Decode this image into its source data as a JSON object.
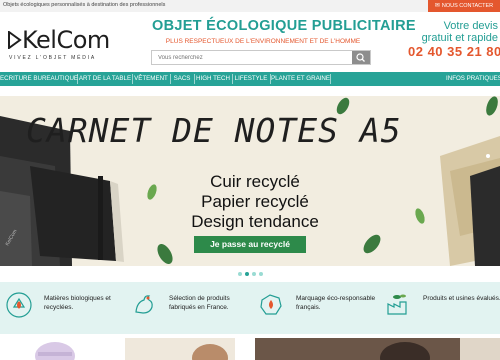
{
  "topbar": {
    "text": "Objets écologiques personnalisés à destination des professionnels",
    "contact_label": "NOUS CONTACTER"
  },
  "header": {
    "logo_text": "KelCom",
    "logo_tagline": "VIVEZ L'OBJET MÉDIA",
    "headline": "OBJET ÉCOLOGIQUE PUBLICITAIRE",
    "subline": "PLUS RESPECTUEUX DE L'ENVIRONNEMENT ET DE L'HOMME",
    "search_placeholder": "Vous recherchez",
    "devis_line1": "Votre devis",
    "devis_line2": "gratuit et rapide",
    "phone": "02 40 35 21 80"
  },
  "nav": {
    "items": [
      "ECRITURE BUREAUTIQUE",
      "ART DE LA TABLE",
      "VÊTEMENT",
      "SACS",
      "HIGH TECH",
      "LIFESTYLE",
      "PLANTE ET GRAINE"
    ],
    "right_item": "INFOS PRATIQUES"
  },
  "hero": {
    "title": "CARNET DE NOTES A5",
    "line1": "Cuir recyclé",
    "line2": "Papier recyclé",
    "line3": "Design tendance",
    "cta": "Je passe au recyclé",
    "slide_count": 4,
    "active_slide": 2
  },
  "features": [
    {
      "text": "Matières biologiques et recyclées.",
      "icon": "recycle-icon"
    },
    {
      "text": "Sélection de produits fabriqués en France.",
      "icon": "rooster-icon"
    },
    {
      "text": "Marquage éco-responsable français.",
      "icon": "france-drop-icon"
    },
    {
      "text": "Produits et usines évalués.",
      "icon": "factory-leaf-icon"
    }
  ],
  "colors": {
    "brand_teal": "#27a397",
    "accent_orange": "#e4572e",
    "cta_green": "#2d8a4a",
    "feature_bg": "#e2f3f1",
    "hero_bg": "#f2ede0"
  }
}
